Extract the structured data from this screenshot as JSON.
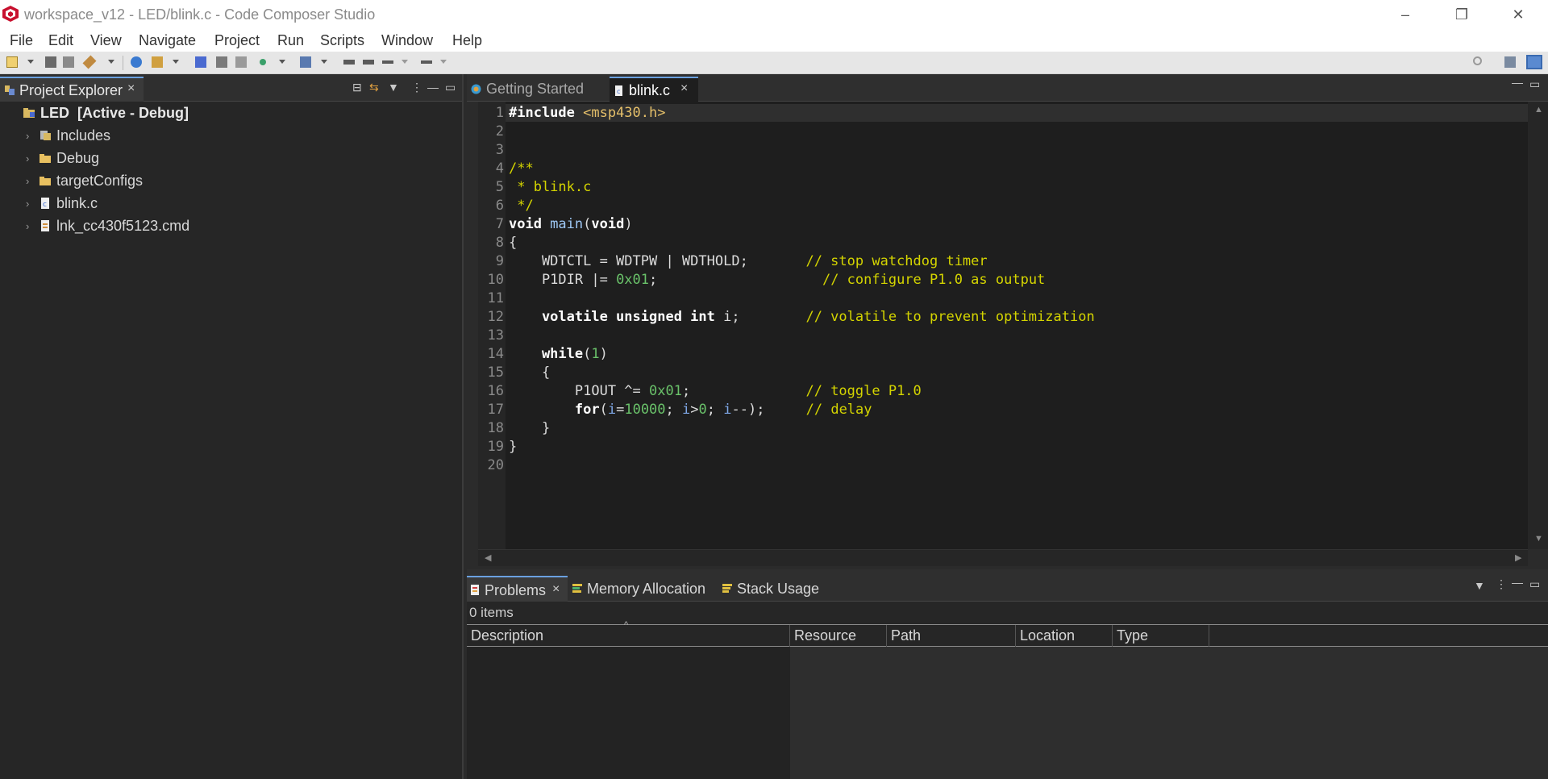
{
  "window": {
    "title": "workspace_v12 - LED/blink.c - Code Composer Studio",
    "controls": {
      "minimize": "–",
      "restore": "❐",
      "close": "✕"
    }
  },
  "menu": [
    "File",
    "Edit",
    "View",
    "Navigate",
    "Project",
    "Run",
    "Scripts",
    "Window",
    "Help"
  ],
  "project_explorer": {
    "tab_label": "Project Explorer",
    "tab_close": "×",
    "tree": {
      "project": "LED  [Active - Debug]",
      "children": [
        "Includes",
        "Debug",
        "targetConfigs",
        "blink.c",
        "lnk_cc430f5123.cmd"
      ]
    }
  },
  "editor": {
    "tabs": [
      {
        "label": "Getting Started",
        "active": false
      },
      {
        "label": "blink.c",
        "active": true,
        "close": "×"
      }
    ],
    "lines": [
      {
        "n": "1",
        "segs": [
          [
            "kw",
            "#include "
          ],
          [
            "inc",
            "<msp430.h>"
          ]
        ]
      },
      {
        "n": "2",
        "segs": []
      },
      {
        "n": "3",
        "segs": []
      },
      {
        "n": "4",
        "segs": [
          [
            "cm",
            "/**"
          ]
        ]
      },
      {
        "n": "5",
        "segs": [
          [
            "cm",
            " * blink.c"
          ]
        ]
      },
      {
        "n": "6",
        "segs": [
          [
            "cm",
            " */"
          ]
        ]
      },
      {
        "n": "7",
        "segs": [
          [
            "kw",
            "void "
          ],
          [
            "fn",
            "main"
          ],
          [
            "",
            "("
          ],
          [
            "kw",
            "void"
          ],
          [
            "",
            ")"
          ]
        ]
      },
      {
        "n": "8",
        "segs": [
          [
            "",
            "{"
          ]
        ]
      },
      {
        "n": "9",
        "segs": [
          [
            "",
            "    WDTCTL = WDTPW | WDTHOLD;       "
          ],
          [
            "cm",
            "// stop watchdog timer"
          ]
        ]
      },
      {
        "n": "10",
        "segs": [
          [
            "",
            "    P1DIR |= "
          ],
          [
            "num",
            "0x01"
          ],
          [
            "",
            ";                    "
          ],
          [
            "cm",
            "// configure P1.0 as output"
          ]
        ]
      },
      {
        "n": "11",
        "segs": []
      },
      {
        "n": "12",
        "segs": [
          [
            "kw",
            "    volatile unsigned int "
          ],
          [
            "",
            "i;        "
          ],
          [
            "cm",
            "// volatile to prevent optimization"
          ]
        ]
      },
      {
        "n": "13",
        "segs": []
      },
      {
        "n": "14",
        "segs": [
          [
            "kw",
            "    while"
          ],
          [
            "",
            "("
          ],
          [
            "num",
            "1"
          ],
          [
            "",
            ")"
          ]
        ]
      },
      {
        "n": "15",
        "segs": [
          [
            "",
            "    {"
          ]
        ]
      },
      {
        "n": "16",
        "segs": [
          [
            "",
            "        P1OUT ^= "
          ],
          [
            "num",
            "0x01"
          ],
          [
            "",
            ";              "
          ],
          [
            "cm",
            "// toggle P1.0"
          ]
        ]
      },
      {
        "n": "17",
        "segs": [
          [
            "kw",
            "        for"
          ],
          [
            "",
            "("
          ],
          [
            "var",
            "i"
          ],
          [
            "",
            "="
          ],
          [
            "num",
            "10000"
          ],
          [
            "",
            "; "
          ],
          [
            "var",
            "i"
          ],
          [
            "",
            ">"
          ],
          [
            "num",
            "0"
          ],
          [
            "",
            "; "
          ],
          [
            "var",
            "i"
          ],
          [
            "",
            "--);     "
          ],
          [
            "cm",
            "// delay"
          ]
        ]
      },
      {
        "n": "18",
        "segs": [
          [
            "",
            "    }"
          ]
        ]
      },
      {
        "n": "19",
        "segs": [
          [
            "",
            "}"
          ]
        ]
      },
      {
        "n": "20",
        "segs": []
      }
    ]
  },
  "bottom": {
    "tabs": [
      {
        "label": "Problems",
        "close": "×"
      },
      {
        "label": "Memory Allocation"
      },
      {
        "label": "Stack Usage"
      }
    ],
    "items_count": "0 items",
    "columns": [
      "Description",
      "Resource",
      "Path",
      "Location",
      "Type"
    ]
  },
  "colors": {
    "accent": "#6aa0e0",
    "editor_bg": "#1e1e1e",
    "comment": "#d4d400",
    "number": "#6ac26a"
  }
}
